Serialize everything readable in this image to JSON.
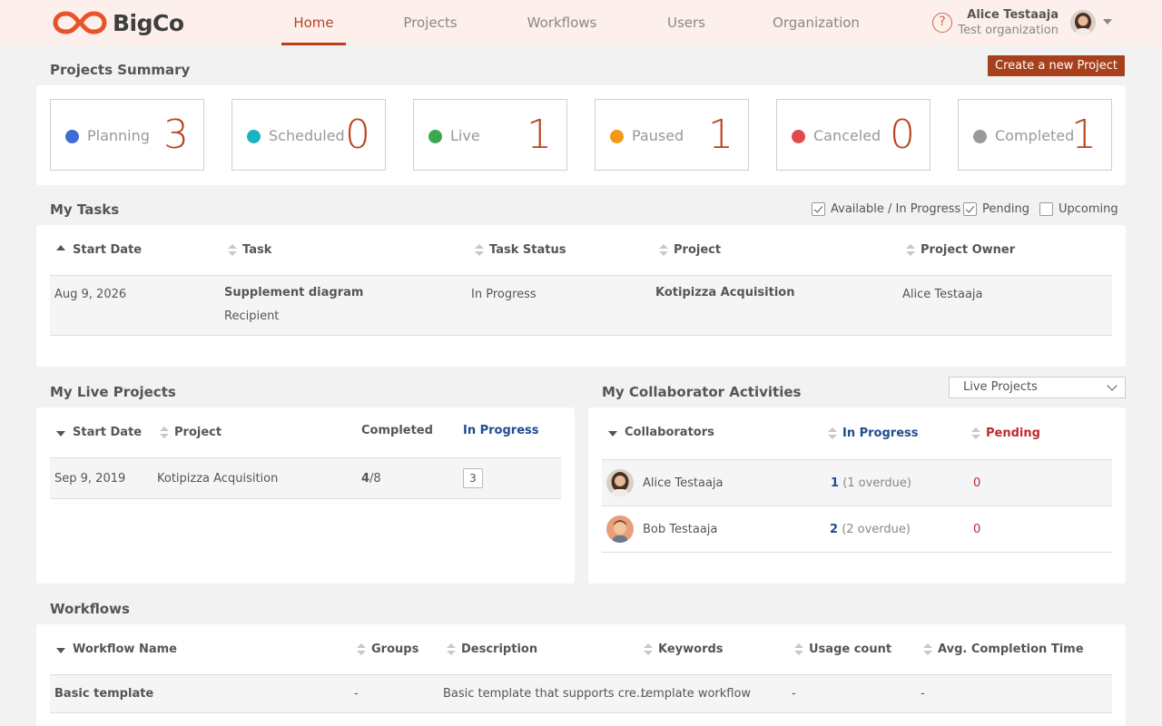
{
  "app": {
    "brand": "BigCo"
  },
  "nav": {
    "items": [
      {
        "label": "Home",
        "active": true
      },
      {
        "label": "Projects",
        "active": false
      },
      {
        "label": "Workflows",
        "active": false
      },
      {
        "label": "Users",
        "active": false
      },
      {
        "label": "Organization",
        "active": false
      }
    ]
  },
  "user": {
    "name": "Alice Testaaja",
    "org": "Test organization",
    "help": "?"
  },
  "summary": {
    "title": "Projects Summary",
    "create_label": "Create a new Project",
    "statuses": [
      {
        "label": "Planning",
        "count": "3",
        "color": "#3f6bd6"
      },
      {
        "label": "Scheduled",
        "count": "0",
        "color": "#19b3c1"
      },
      {
        "label": "Live",
        "count": "1",
        "color": "#3aa84f"
      },
      {
        "label": "Paused",
        "count": "1",
        "color": "#f39a14"
      },
      {
        "label": "Canceled",
        "count": "0",
        "color": "#e04a4f"
      },
      {
        "label": "Completed",
        "count": "1",
        "color": "#9a9a9a"
      }
    ]
  },
  "tasks": {
    "title": "My Tasks",
    "filters": [
      {
        "label": "Available / In Progress",
        "checked": true
      },
      {
        "label": "Pending",
        "checked": true
      },
      {
        "label": "Upcoming",
        "checked": false
      }
    ],
    "columns": [
      "Start Date",
      "Task",
      "Task Status",
      "Project",
      "Project Owner"
    ],
    "rows": [
      {
        "start": "Aug 9, 2026",
        "task": "Supplement diagram",
        "task_sub": "Recipient",
        "status": "In Progress",
        "project": "Kotipizza Acquisition",
        "owner": "Alice Testaaja"
      }
    ]
  },
  "live_projects": {
    "title": "My Live Projects",
    "columns": [
      "Start Date",
      "Project",
      "Completed",
      "In Progress"
    ],
    "rows": [
      {
        "start": "Sep 9, 2019",
        "project": "Kotipizza Acquisition",
        "done": "4",
        "total": "/8",
        "in_progress": "3"
      }
    ]
  },
  "collab": {
    "title": "My Collaborator Activities",
    "filter": "Live Projects",
    "columns": [
      "Collaborators",
      "In Progress",
      "Pending"
    ],
    "rows": [
      {
        "name": "Alice Testaaja",
        "in_progress": "1",
        "overdue": "(1 overdue)",
        "pending": "0"
      },
      {
        "name": "Bob Testaaja",
        "in_progress": "2",
        "overdue": "(2 overdue)",
        "pending": "0"
      }
    ]
  },
  "workflows": {
    "title": "Workflows",
    "columns": [
      "Workflow Name",
      "Groups",
      "Description",
      "Keywords",
      "Usage count",
      "Avg. Completion Time"
    ],
    "rows": [
      {
        "name": "Basic template",
        "groups": "-",
        "description": "Basic template that supports cre...",
        "keywords": "template workflow",
        "usage": "-",
        "avg": "-"
      }
    ]
  }
}
